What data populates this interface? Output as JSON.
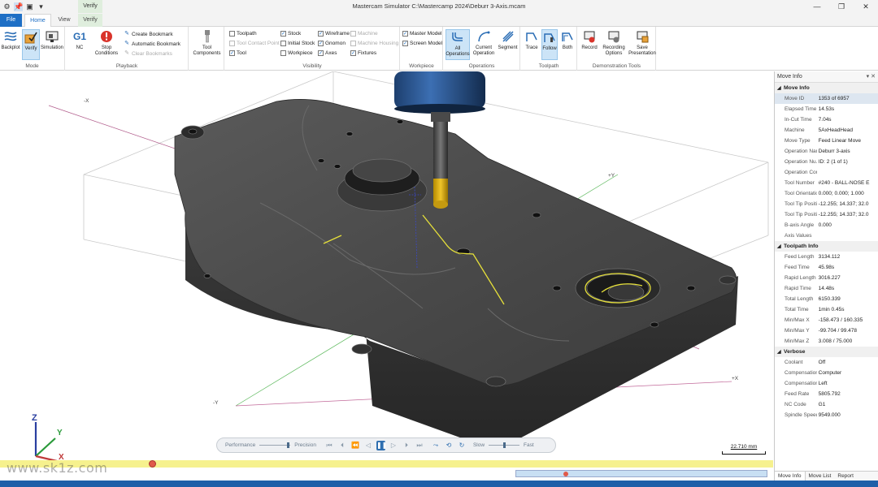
{
  "window": {
    "title": "Mastercam Simulator  C:\\Mastercamp 2024\\Deburr 3-Axis.mcam",
    "context_tab": "Verify",
    "buttons": {
      "minimize": "—",
      "restore": "❐",
      "close": "✕"
    }
  },
  "quick_access": [
    "gear-icon",
    "pin-icon",
    "monitor-icon",
    "dropdown-icon"
  ],
  "tabs": {
    "file": "File",
    "home": "Home",
    "view": "View",
    "verify": "Verify"
  },
  "ribbon": {
    "mode": {
      "label": "Mode",
      "backplot": "Backplot",
      "verify": "Verify",
      "simulation": "Simulation"
    },
    "playback": {
      "label": "Playback",
      "nc": "NC",
      "nc_icon_text": "G1",
      "stop_conditions": "Stop Conditions",
      "create_bookmark": "Create Bookmark",
      "automatic_bookmark": "Automatic Bookmark",
      "clear_bookmarks": "Clear Bookmarks"
    },
    "tool_components": "Tool Components",
    "visibility": {
      "label": "Visibility",
      "toolpath": "Toolpath",
      "tool_contact_point": "Tool Contact Point",
      "tool": "Tool",
      "stock": "Stock",
      "initial_stock": "Initial Stock",
      "workpiece": "Workpiece",
      "wireframe": "Wireframe",
      "gnomon": "Gnomon",
      "axes": "Axes",
      "machine": "Machine",
      "machine_housing": "Machine Housing",
      "fixtures": "Fixtures"
    },
    "workpiece": {
      "label": "Workpiece",
      "master_model": "Master Model",
      "screen_model": "Screen Model"
    },
    "operations": {
      "label": "Operations",
      "all_operations": "All Operations",
      "current_operation": "Current Operation",
      "segment": "Segment"
    },
    "toolpath": {
      "label": "Toolpath",
      "trace": "Trace",
      "follow": "Follow",
      "both": "Both"
    },
    "demonstration": {
      "label": "Demonstration Tools",
      "record": "Record",
      "recording_options": "Recording Options",
      "save_presentation": "Save Presentation"
    }
  },
  "viewport": {
    "axis_labels": {
      "neg_x": "-X",
      "pos_x": "+Y",
      "neg_y": "-Y",
      "pos_y": "+X"
    },
    "gnomon": {
      "x": "X",
      "y": "Y",
      "z": "Z"
    }
  },
  "playback_bar": {
    "performance": "Performance",
    "precision": "Precision",
    "slow": "Slow",
    "fast": "Fast"
  },
  "scale": "22.710 mm",
  "watermark": "www.sk1z.com",
  "panel": {
    "title": "Move Info",
    "sections": [
      {
        "name": "Move Info",
        "rows": [
          {
            "k": "Move ID",
            "v": "1353 of 6957"
          },
          {
            "k": "Elapsed Time",
            "v": "14.53s"
          },
          {
            "k": "In-Cut Time",
            "v": "7.04s"
          },
          {
            "k": "Machine",
            "v": "5AxHeadHead"
          },
          {
            "k": "Move Type",
            "v": "Feed Linear Move"
          },
          {
            "k": "Operation Name",
            "v": "Deburr 3-axis"
          },
          {
            "k": "Operation Nu...",
            "v": "ID: 2 (1 of 1)"
          },
          {
            "k": "Operation Com...",
            "v": ""
          },
          {
            "k": "Tool Number",
            "v": "#240 - BALL-NOSE E"
          },
          {
            "k": "Tool Orientation",
            "v": "0.000; 0.000; 1.000"
          },
          {
            "k": "Tool Tip Positio...",
            "v": "-12.255; 14.337; 32.0"
          },
          {
            "k": "Tool Tip Positio...",
            "v": "-12.255; 14.337; 32.0"
          },
          {
            "k": "B-axis Angle",
            "v": "0.000"
          },
          {
            "k": "Axis Values",
            "v": ""
          }
        ]
      },
      {
        "name": "Toolpath Info",
        "rows": [
          {
            "k": "Feed Length",
            "v": "3134.112"
          },
          {
            "k": "Feed Time",
            "v": "45.98s"
          },
          {
            "k": "Rapid Length",
            "v": "3016.227"
          },
          {
            "k": "Rapid Time",
            "v": "14.48s"
          },
          {
            "k": "Total Length",
            "v": "6150.339"
          },
          {
            "k": "Total Time",
            "v": "1min 0.45s"
          },
          {
            "k": "Min/Max X",
            "v": "-158.473 / 160.335"
          },
          {
            "k": "Min/Max Y",
            "v": "-99.704 / 99.478"
          },
          {
            "k": "Min/Max Z",
            "v": "3.008 / 75.000"
          }
        ]
      },
      {
        "name": "Verbose",
        "rows": [
          {
            "k": "Coolant",
            "v": "Off"
          },
          {
            "k": "Compensation...",
            "v": "Computer"
          },
          {
            "k": "Compensation...",
            "v": "Left"
          },
          {
            "k": "Feed Rate",
            "v": "5805.792"
          },
          {
            "k": "NC Code",
            "v": "G1"
          },
          {
            "k": "Spindle Speed",
            "v": "9549.000"
          }
        ]
      }
    ],
    "tabs": [
      "Move Info",
      "Move List",
      "Report"
    ]
  }
}
